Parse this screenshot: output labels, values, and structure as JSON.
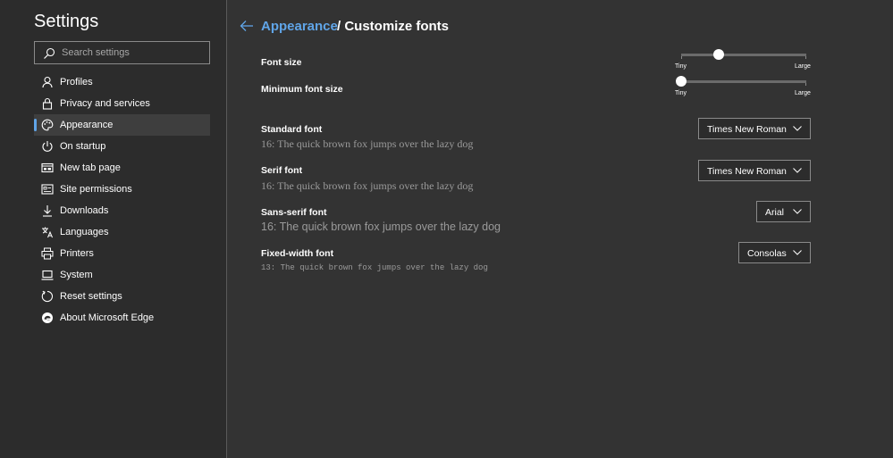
{
  "sidebar": {
    "title": "Settings",
    "search_placeholder": "Search settings",
    "items": [
      {
        "label": "Profiles",
        "icon": "person-icon"
      },
      {
        "label": "Privacy and services",
        "icon": "lock-icon"
      },
      {
        "label": "Appearance",
        "icon": "palette-icon",
        "selected": true
      },
      {
        "label": "On startup",
        "icon": "power-icon"
      },
      {
        "label": "New tab page",
        "icon": "new-tab-icon"
      },
      {
        "label": "Site permissions",
        "icon": "site-permissions-icon"
      },
      {
        "label": "Downloads",
        "icon": "download-icon"
      },
      {
        "label": "Languages",
        "icon": "languages-icon"
      },
      {
        "label": "Printers",
        "icon": "printer-icon"
      },
      {
        "label": "System",
        "icon": "laptop-icon"
      },
      {
        "label": "Reset settings",
        "icon": "reset-icon"
      },
      {
        "label": "About Microsoft Edge",
        "icon": "edge-icon"
      }
    ]
  },
  "header": {
    "breadcrumb_link": "Appearance",
    "breadcrumb_current": "/ Customize fonts"
  },
  "settings": {
    "font_size": {
      "label": "Font size",
      "min_label": "Tiny",
      "max_label": "Large",
      "level": 0.3
    },
    "min_font_size": {
      "label": "Minimum font size",
      "min_label": "Tiny",
      "max_label": "Large",
      "level": 0.0
    },
    "standard_font": {
      "label": "Standard font",
      "sample": "16: The quick brown fox jumps over the lazy dog",
      "value": "Times New Roman"
    },
    "serif_font": {
      "label": "Serif font",
      "sample": "16: The quick brown fox jumps over the lazy dog",
      "value": "Times New Roman"
    },
    "sans_serif_font": {
      "label": "Sans-serif font",
      "sample": "16: The quick brown fox jumps over the lazy dog",
      "value": "Arial"
    },
    "fixed_width_font": {
      "label": "Fixed-width font",
      "sample": "13: The quick brown fox jumps over the lazy dog",
      "value": "Consolas"
    }
  },
  "colors": {
    "accent": "#60a5e8",
    "background": "#333333",
    "sidebar_background": "#2c2c2c"
  }
}
